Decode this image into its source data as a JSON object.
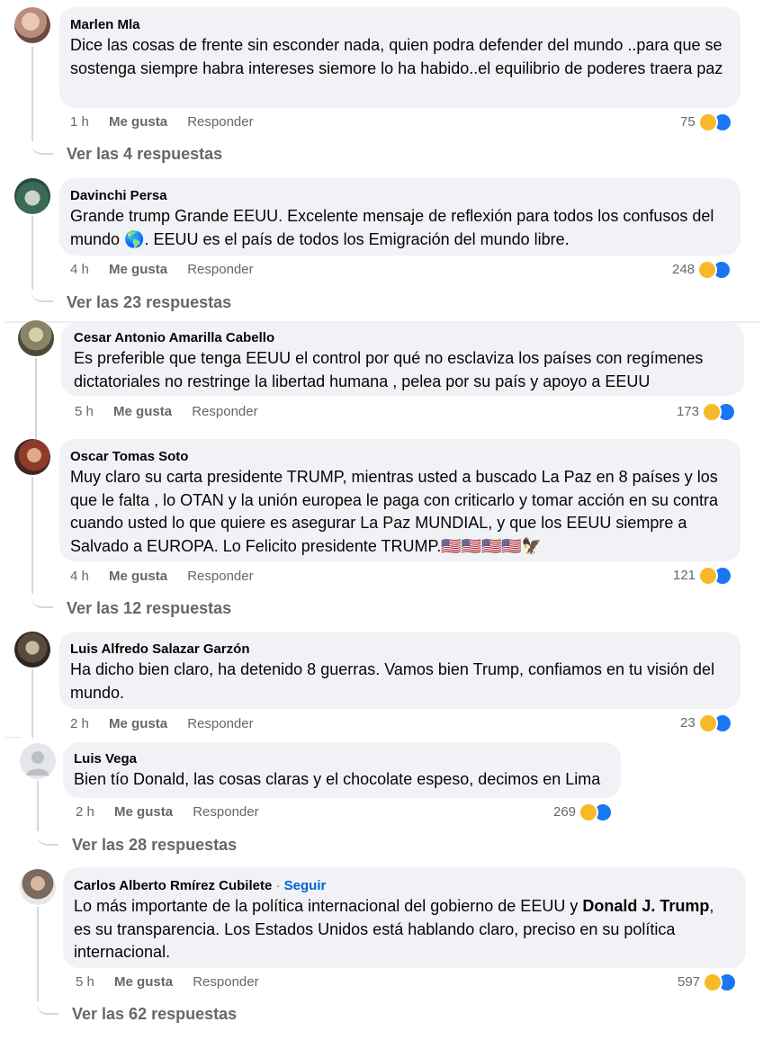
{
  "comments": [
    {
      "author": "Marlen Mla",
      "text": "Dice las cosas de frente sin esconder nada, quien podra defender del mundo ..para que se sostenga siempre habra intereses siemore lo ha habido..el equilibrio de poderes traera paz",
      "time": "1 h",
      "like": "Me gusta",
      "reply": "Responder",
      "count": "75",
      "more": "Ver las 4 respuestas"
    },
    {
      "author": "Davinchi Persa",
      "text": "Grande trump Grande EEUU. Excelente mensaje de reflexión para todos los confusos del mundo 🌎. EEUU es el país de todos los Emigración del mundo libre.",
      "time": "4 h",
      "like": "Me gusta",
      "reply": "Responder",
      "count": "248",
      "more": "Ver las 23 respuestas"
    },
    {
      "author": "Cesar Antonio Amarilla Cabello",
      "text": "Es preferible que tenga EEUU el control por qué no esclaviza los países con regímenes dictatoriales no restringe la libertad humana , pelea por su país y apoyo a EEUU",
      "time": "5 h",
      "like": "Me gusta",
      "reply": "Responder",
      "count": "173"
    },
    {
      "author": "Oscar Tomas Soto",
      "text": "Muy claro su carta presidente TRUMP, mientras usted a buscado La Paz en 8 países y los que le falta , lo OTAN y la unión europea le paga con criticarlo y tomar acción en su contra cuando usted lo que quiere es asegurar La Paz MUNDIAL, y que los EEUU siempre a Salvado a EUROPA. Lo Felicito presidente TRUMP.🇺🇸🇺🇸🇺🇸🇺🇸🦅",
      "time": "4 h",
      "like": "Me gusta",
      "reply": "Responder",
      "count": "121",
      "more": "Ver las 12 respuestas"
    },
    {
      "author": "Luis Alfredo Salazar Garzón",
      "text": "Ha dicho bien claro, ha detenido 8 guerras. Vamos bien Trump, confiamos en tu visión del mundo.",
      "time": "2 h",
      "like": "Me gusta",
      "reply": "Responder",
      "count": "23"
    },
    {
      "author": "Luis Vega",
      "text": "Bien tío Donald, las cosas claras y el chocolate espeso, decimos en Lima",
      "time": "2 h",
      "like": "Me gusta",
      "reply": "Responder",
      "count": "269",
      "more": "Ver las 28 respuestas"
    },
    {
      "author": "Carlos Alberto Rmírez Cubilete",
      "follow_sep": "·",
      "follow": "Seguir",
      "text_before": "Lo más importante de la política internacional del gobierno de EEUU y ",
      "text_bold": "Donald J. Trump",
      "text_after": ", es su transparencia. Los Estados Unidos está hablando claro, preciso en su política internacional.",
      "time": "5 h",
      "like": "Me gusta",
      "reply": "Responder",
      "count": "597",
      "more": "Ver las 62 respuestas"
    }
  ],
  "colors": {
    "bubble": "#f0f2f5",
    "meta": "#65676b",
    "link": "#0064d1",
    "haha": "#f7b928",
    "like": "#1877f2"
  },
  "icons": {
    "reaction_1": "haha-reaction-icon",
    "reaction_2": "like-reaction-icon",
    "default_avatar": "default-avatar-icon"
  }
}
